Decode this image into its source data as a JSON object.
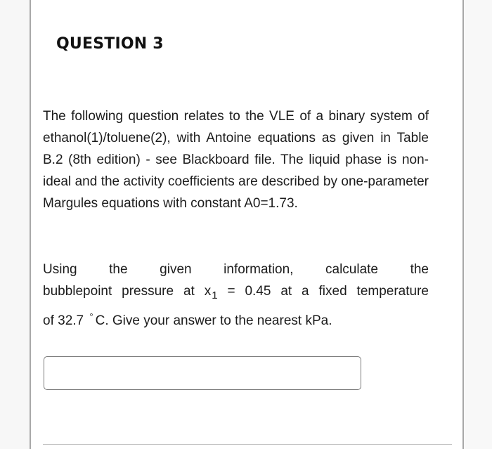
{
  "question": {
    "heading": "QUESTION 3",
    "paragraph1": "The following question relates to the VLE of a binary system of ethanol(1)/toluene(2), with Antoine equations as given in Table B.2 (8th edition) - see Blackboard file. The liquid phase is non-ideal and the activity coefficients are described by one-parameter Margules equations with constant  A0=1.73.",
    "paragraph2": {
      "line1": "Using the given information, calculate the",
      "line2_before_subscript": "bubblepoint pressure at x",
      "subscript": "1",
      "line2_after_subscript": " = 0.45 at a fixed temperature",
      "line3_before_degree": "of 32.7 ",
      "degree_symbol": "°",
      "line3_after_degree": "C. Give your answer to the nearest kPa."
    }
  },
  "answer": {
    "value": "",
    "placeholder": ""
  }
}
